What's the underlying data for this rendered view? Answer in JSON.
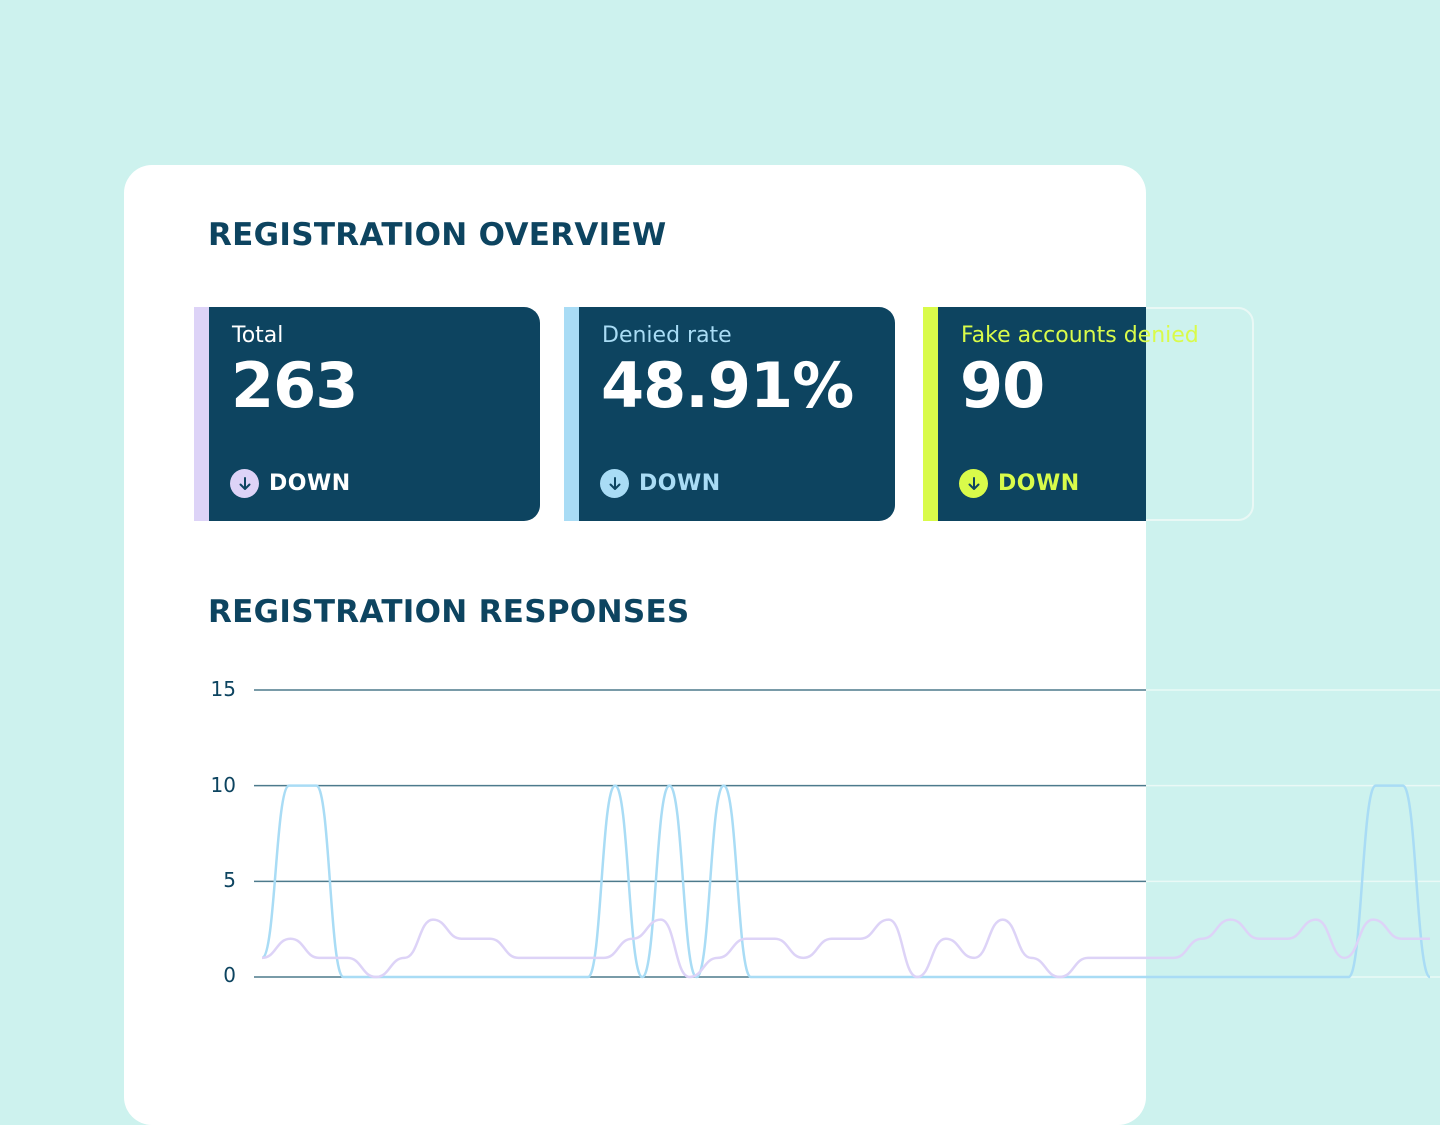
{
  "overview": {
    "title": "REGISTRATION OVERVIEW"
  },
  "cards": [
    {
      "label": "Total",
      "value": "263",
      "trend": "DOWN",
      "accent": "#ddd3f7"
    },
    {
      "label": "Denied rate",
      "value": "48.91%",
      "trend": "DOWN",
      "accent": "#a9dcf5"
    },
    {
      "label": "Fake accounts denied",
      "value": "90",
      "trend": "DOWN",
      "accent": "#d9fb4a"
    }
  ],
  "responses": {
    "title": "REGISTRATION RESPONSES"
  },
  "chart_data": {
    "type": "line",
    "y_ticks": [
      "15",
      "10",
      "5",
      "0"
    ],
    "ylim": [
      0,
      15
    ],
    "grid": true,
    "series": [
      {
        "color": "#a9dcf5",
        "values": [
          1,
          10,
          10,
          0,
          0,
          0,
          0,
          0,
          0,
          0,
          0,
          0,
          0,
          10,
          0,
          10,
          0,
          10,
          0,
          0,
          0,
          0,
          0,
          0,
          0,
          0,
          0,
          0,
          0,
          0,
          0,
          0,
          0,
          0,
          0,
          0,
          0,
          0,
          0,
          0,
          0,
          10,
          10,
          0
        ]
      },
      {
        "color": "#ddd3f7",
        "values": [
          1,
          2,
          1,
          1,
          0,
          1,
          3,
          2,
          2,
          1,
          1,
          1,
          1,
          2,
          3,
          0,
          1,
          2,
          2,
          1,
          2,
          2,
          3,
          0,
          2,
          1,
          3,
          1,
          0,
          1,
          1,
          1,
          1,
          2,
          3,
          2,
          2,
          3,
          1,
          3,
          2,
          2
        ]
      }
    ]
  },
  "colors": {
    "navy": "#0d4460",
    "background": "#cdf2ee",
    "panel": "#ffffff"
  }
}
